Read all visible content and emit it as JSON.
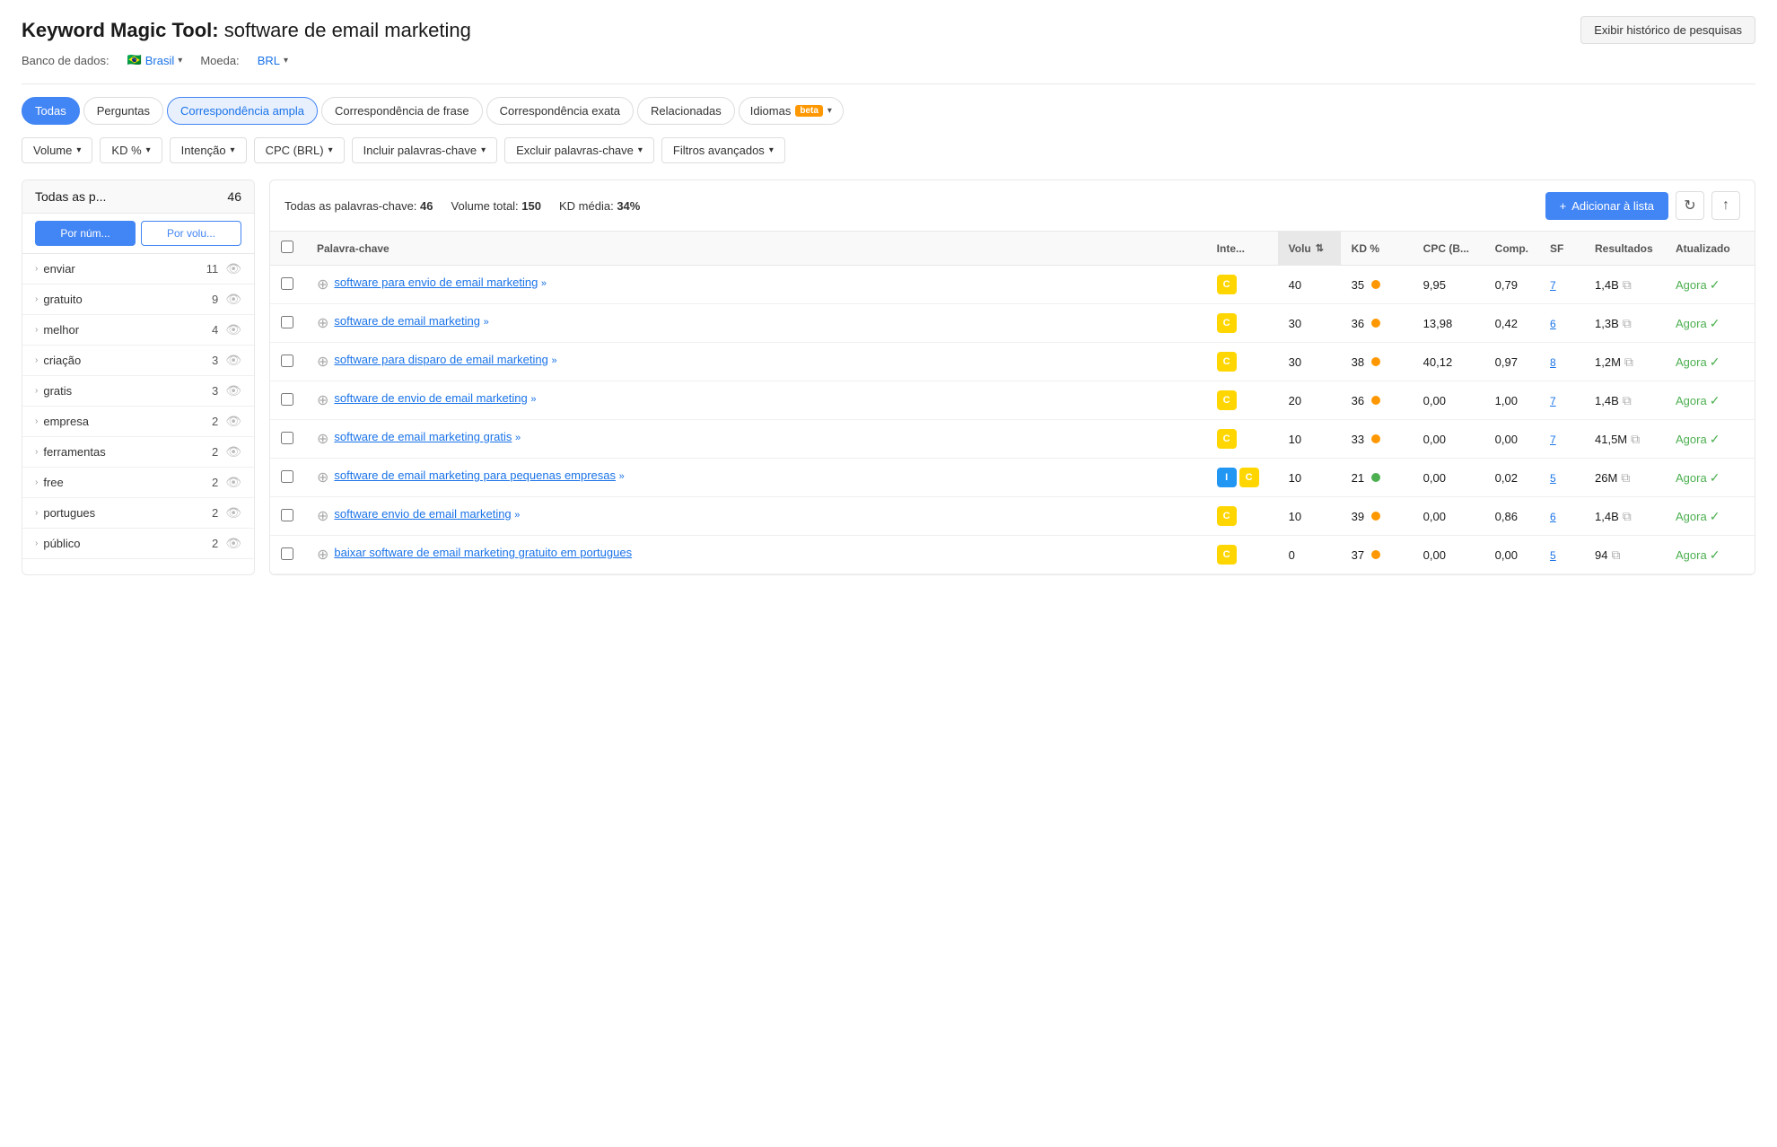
{
  "header": {
    "tool_name": "Keyword Magic Tool:",
    "query": "software de email marketing",
    "history_button": "Exibir histórico de pesquisas"
  },
  "subheader": {
    "database_label": "Banco de dados:",
    "database_flag": "🇧🇷",
    "database_value": "Brasil",
    "currency_label": "Moeda:",
    "currency_value": "BRL"
  },
  "tabs": [
    {
      "label": "Todas",
      "active": true
    },
    {
      "label": "Perguntas",
      "active": false
    },
    {
      "label": "Correspondência ampla",
      "active": true,
      "style": "blue-border"
    },
    {
      "label": "Correspondência de frase",
      "active": false
    },
    {
      "label": "Correspondência exata",
      "active": false
    },
    {
      "label": "Relacionadas",
      "active": false
    },
    {
      "label": "Idiomas",
      "beta": true,
      "active": false
    }
  ],
  "filters": [
    {
      "label": "Volume"
    },
    {
      "label": "KD %"
    },
    {
      "label": "Intenção"
    },
    {
      "label": "CPC (BRL)"
    },
    {
      "label": "Incluir palavras-chave"
    },
    {
      "label": "Excluir palavras-chave"
    },
    {
      "label": "Filtros avançados"
    }
  ],
  "sidebar": {
    "header_title": "Todas as p...",
    "header_count": "46",
    "btn_by_number": "Por núm...",
    "btn_by_volume": "Por volu...",
    "items": [
      {
        "label": "enviar",
        "count": 11
      },
      {
        "label": "gratuito",
        "count": 9
      },
      {
        "label": "melhor",
        "count": 4
      },
      {
        "label": "criação",
        "count": 3
      },
      {
        "label": "gratis",
        "count": 3
      },
      {
        "label": "empresa",
        "count": 2
      },
      {
        "label": "ferramentas",
        "count": 2
      },
      {
        "label": "free",
        "count": 2
      },
      {
        "label": "portugues",
        "count": 2
      },
      {
        "label": "público",
        "count": 2
      }
    ]
  },
  "main": {
    "total_keywords_label": "Todas as palavras-chave:",
    "total_keywords_value": "46",
    "total_volume_label": "Volume total:",
    "total_volume_value": "150",
    "kd_avg_label": "KD média:",
    "kd_avg_value": "34%",
    "add_btn_label": "+ Adicionar à lista"
  },
  "table": {
    "columns": [
      {
        "label": "",
        "key": "checkbox"
      },
      {
        "label": "Palavra-chave",
        "key": "keyword"
      },
      {
        "label": "Inte...",
        "key": "intent"
      },
      {
        "label": "Volu",
        "key": "volume",
        "sorted": true
      },
      {
        "label": "KD %",
        "key": "kd"
      },
      {
        "label": "CPC (B...",
        "key": "cpc"
      },
      {
        "label": "Comp.",
        "key": "comp"
      },
      {
        "label": "SF",
        "key": "sf"
      },
      {
        "label": "Resultados",
        "key": "results"
      },
      {
        "label": "Atualizado",
        "key": "updated"
      }
    ],
    "rows": [
      {
        "keyword": "software para envio de email marketing",
        "keyword_suffix": "»",
        "intent": [
          "C"
        ],
        "volume": 40,
        "kd": 35,
        "kd_dot": "orange",
        "cpc": "9,95",
        "comp": "0,79",
        "sf": "7",
        "sf_underline": true,
        "results": "1,4B",
        "updated": "Agora"
      },
      {
        "keyword": "software de email marketing",
        "keyword_suffix": "»",
        "intent": [
          "C"
        ],
        "volume": 30,
        "kd": 36,
        "kd_dot": "orange",
        "cpc": "13,98",
        "comp": "0,42",
        "sf": "6",
        "sf_underline": true,
        "results": "1,3B",
        "updated": "Agora"
      },
      {
        "keyword": "software para disparo de email marketing",
        "keyword_suffix": "»",
        "intent": [
          "C"
        ],
        "volume": 30,
        "kd": 38,
        "kd_dot": "orange",
        "cpc": "40,12",
        "comp": "0,97",
        "sf": "8",
        "sf_underline": true,
        "results": "1,2M",
        "updated": "Agora"
      },
      {
        "keyword": "software de envio de email marketing",
        "keyword_suffix": "»",
        "intent": [
          "C"
        ],
        "volume": 20,
        "kd": 36,
        "kd_dot": "orange",
        "cpc": "0,00",
        "comp": "1,00",
        "sf": "7",
        "sf_underline": true,
        "results": "1,4B",
        "updated": "Agora"
      },
      {
        "keyword": "software de email marketing gratis",
        "keyword_suffix": "»",
        "intent": [
          "C"
        ],
        "volume": 10,
        "kd": 33,
        "kd_dot": "orange",
        "cpc": "0,00",
        "comp": "0,00",
        "sf": "7",
        "sf_underline": true,
        "results": "41,5M",
        "updated": "Agora"
      },
      {
        "keyword": "software de email marketing para pequenas empresas",
        "keyword_suffix": "»",
        "intent": [
          "I",
          "C"
        ],
        "volume": 10,
        "kd": 21,
        "kd_dot": "green",
        "cpc": "0,00",
        "comp": "0,02",
        "sf": "5",
        "sf_underline": true,
        "results": "26M",
        "updated": "Agora"
      },
      {
        "keyword": "software envio de email marketing",
        "keyword_suffix": "»",
        "intent": [
          "C"
        ],
        "volume": 10,
        "kd": 39,
        "kd_dot": "orange",
        "cpc": "0,00",
        "comp": "0,86",
        "sf": "6",
        "sf_underline": true,
        "results": "1,4B",
        "updated": "Agora"
      },
      {
        "keyword": "baixar software de email marketing gratuito em portugues",
        "keyword_suffix": "",
        "intent": [
          "C"
        ],
        "volume": 0,
        "kd": 37,
        "kd_dot": "orange",
        "cpc": "0,00",
        "comp": "0,00",
        "sf": "5",
        "sf_underline": true,
        "results": "94",
        "updated": "Agora"
      }
    ]
  }
}
